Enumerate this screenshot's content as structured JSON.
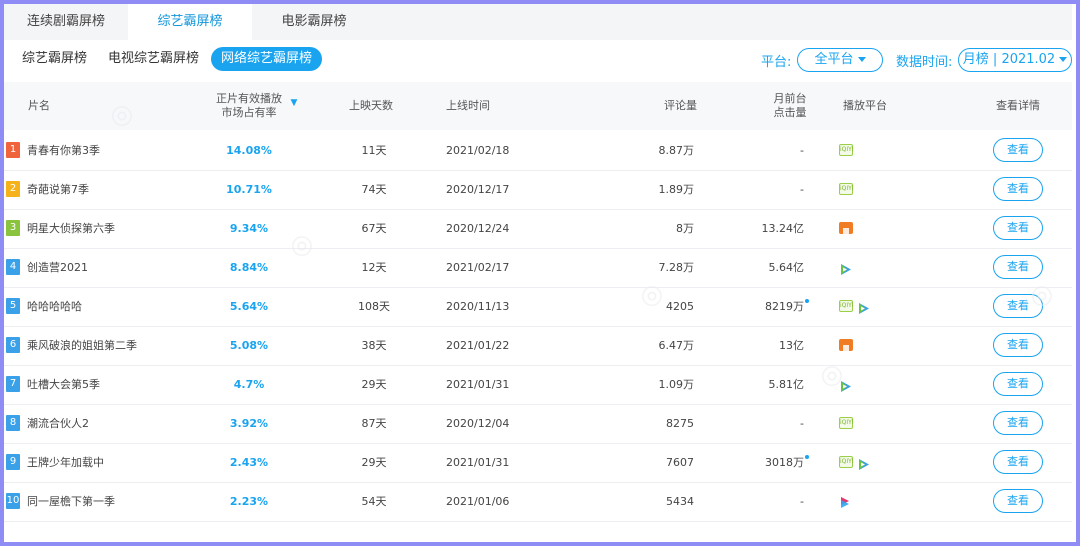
{
  "top_tabs": [
    "连续剧霸屏榜",
    "综艺霸屏榜",
    "电影霸屏榜"
  ],
  "sub_tabs": [
    "综艺霸屏榜",
    "电视综艺霸屏榜",
    "网络综艺霸屏榜"
  ],
  "filters": {
    "platform_label": "平台:",
    "platform_value": "全平台",
    "time_label": "数据时间:",
    "time_value": "月榜 | 2021.02"
  },
  "headers": {
    "title": "片名",
    "share_line1": "正片有效播放",
    "share_line2": "市场占有率",
    "days": "上映天数",
    "date": "上线时间",
    "comments": "评论量",
    "clicks_line1": "月前台",
    "clicks_line2": "点击量",
    "platform": "播放平台",
    "detail": "查看详情"
  },
  "view_label": "查看",
  "colors": {
    "accent": "#1aa4f0",
    "rank1": "#f0643c",
    "rank2": "#f5b21a",
    "rank3": "#8ac43f",
    "rank_other": "#3aa0e8"
  },
  "rows": [
    {
      "rank": "1",
      "title": "青春有你第3季",
      "share": "14.08%",
      "days": "11天",
      "date": "2021/02/18",
      "comments": "8.87万",
      "clicks": "-",
      "platforms": [
        "iqiyi"
      ]
    },
    {
      "rank": "2",
      "title": "奇葩说第7季",
      "share": "10.71%",
      "days": "74天",
      "date": "2020/12/17",
      "comments": "1.89万",
      "clicks": "-",
      "platforms": [
        "iqiyi"
      ]
    },
    {
      "rank": "3",
      "title": "明星大侦探第六季",
      "share": "9.34%",
      "days": "67天",
      "date": "2020/12/24",
      "comments": "8万",
      "clicks": "13.24亿",
      "platforms": [
        "mango"
      ]
    },
    {
      "rank": "4",
      "title": "创造营2021",
      "share": "8.84%",
      "days": "12天",
      "date": "2021/02/17",
      "comments": "7.28万",
      "clicks": "5.64亿",
      "platforms": [
        "tencent"
      ]
    },
    {
      "rank": "5",
      "title": "哈哈哈哈哈",
      "share": "5.64%",
      "days": "108天",
      "date": "2020/11/13",
      "comments": "4205",
      "clicks": "8219万",
      "platforms": [
        "iqiyi",
        "tencent"
      ]
    },
    {
      "rank": "6",
      "title": "乘风破浪的姐姐第二季",
      "share": "5.08%",
      "days": "38天",
      "date": "2021/01/22",
      "comments": "6.47万",
      "clicks": "13亿",
      "platforms": [
        "mango"
      ]
    },
    {
      "rank": "7",
      "title": "吐槽大会第5季",
      "share": "4.7%",
      "days": "29天",
      "date": "2021/01/31",
      "comments": "1.09万",
      "clicks": "5.81亿",
      "platforms": [
        "tencent"
      ]
    },
    {
      "rank": "8",
      "title": "潮流合伙人2",
      "share": "3.92%",
      "days": "87天",
      "date": "2020/12/04",
      "comments": "8275",
      "clicks": "-",
      "platforms": [
        "iqiyi"
      ]
    },
    {
      "rank": "9",
      "title": "王牌少年加载中",
      "share": "2.43%",
      "days": "29天",
      "date": "2021/01/31",
      "comments": "7607",
      "clicks": "3018万",
      "platforms": [
        "iqiyi",
        "tencent"
      ]
    },
    {
      "rank": "10",
      "title": "同一屋檐下第一季",
      "share": "2.23%",
      "days": "54天",
      "date": "2021/01/06",
      "comments": "5434",
      "clicks": "-",
      "platforms": [
        "youku"
      ]
    }
  ]
}
